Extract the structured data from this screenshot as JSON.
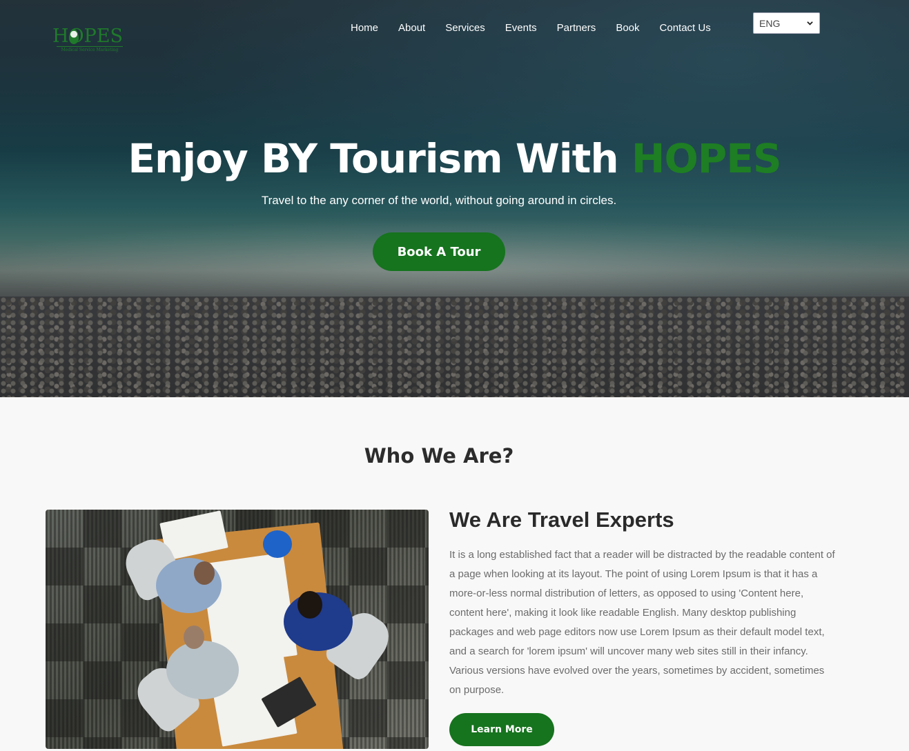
{
  "logo": {
    "text": "HOPES",
    "subtitle": "Medical Service Marketing"
  },
  "nav": {
    "items": [
      "Home",
      "About",
      "Services",
      "Events",
      "Partners",
      "Book",
      "Contact Us"
    ]
  },
  "language": {
    "selected": "ENG"
  },
  "hero": {
    "title_prefix": "Enjoy BY Tourism With ",
    "title_brand": "HOPES",
    "subtitle": "Travel to the any corner of the world, without going around in circles.",
    "button": "Book A Tour"
  },
  "about": {
    "section_title": "Who We Are?",
    "heading": "We Are Travel Experts",
    "paragraph": "It is a long established fact that a reader will be distracted by the readable content of a page when looking at its layout. The point of using Lorem Ipsum is that it has a more-or-less normal distribution of letters, as opposed to using 'Content here, content here', making it look like readable English. Many desktop publishing packages and web page editors now use Lorem Ipsum as their default model text, and a search for 'lorem ipsum' will uncover many web sites still in their infancy. Various versions have evolved over the years, sometimes by accident, sometimes on purpose.",
    "button": "Learn More"
  },
  "colors": {
    "brand_green": "#16731e",
    "hero_brand_text": "#1e7e23"
  }
}
